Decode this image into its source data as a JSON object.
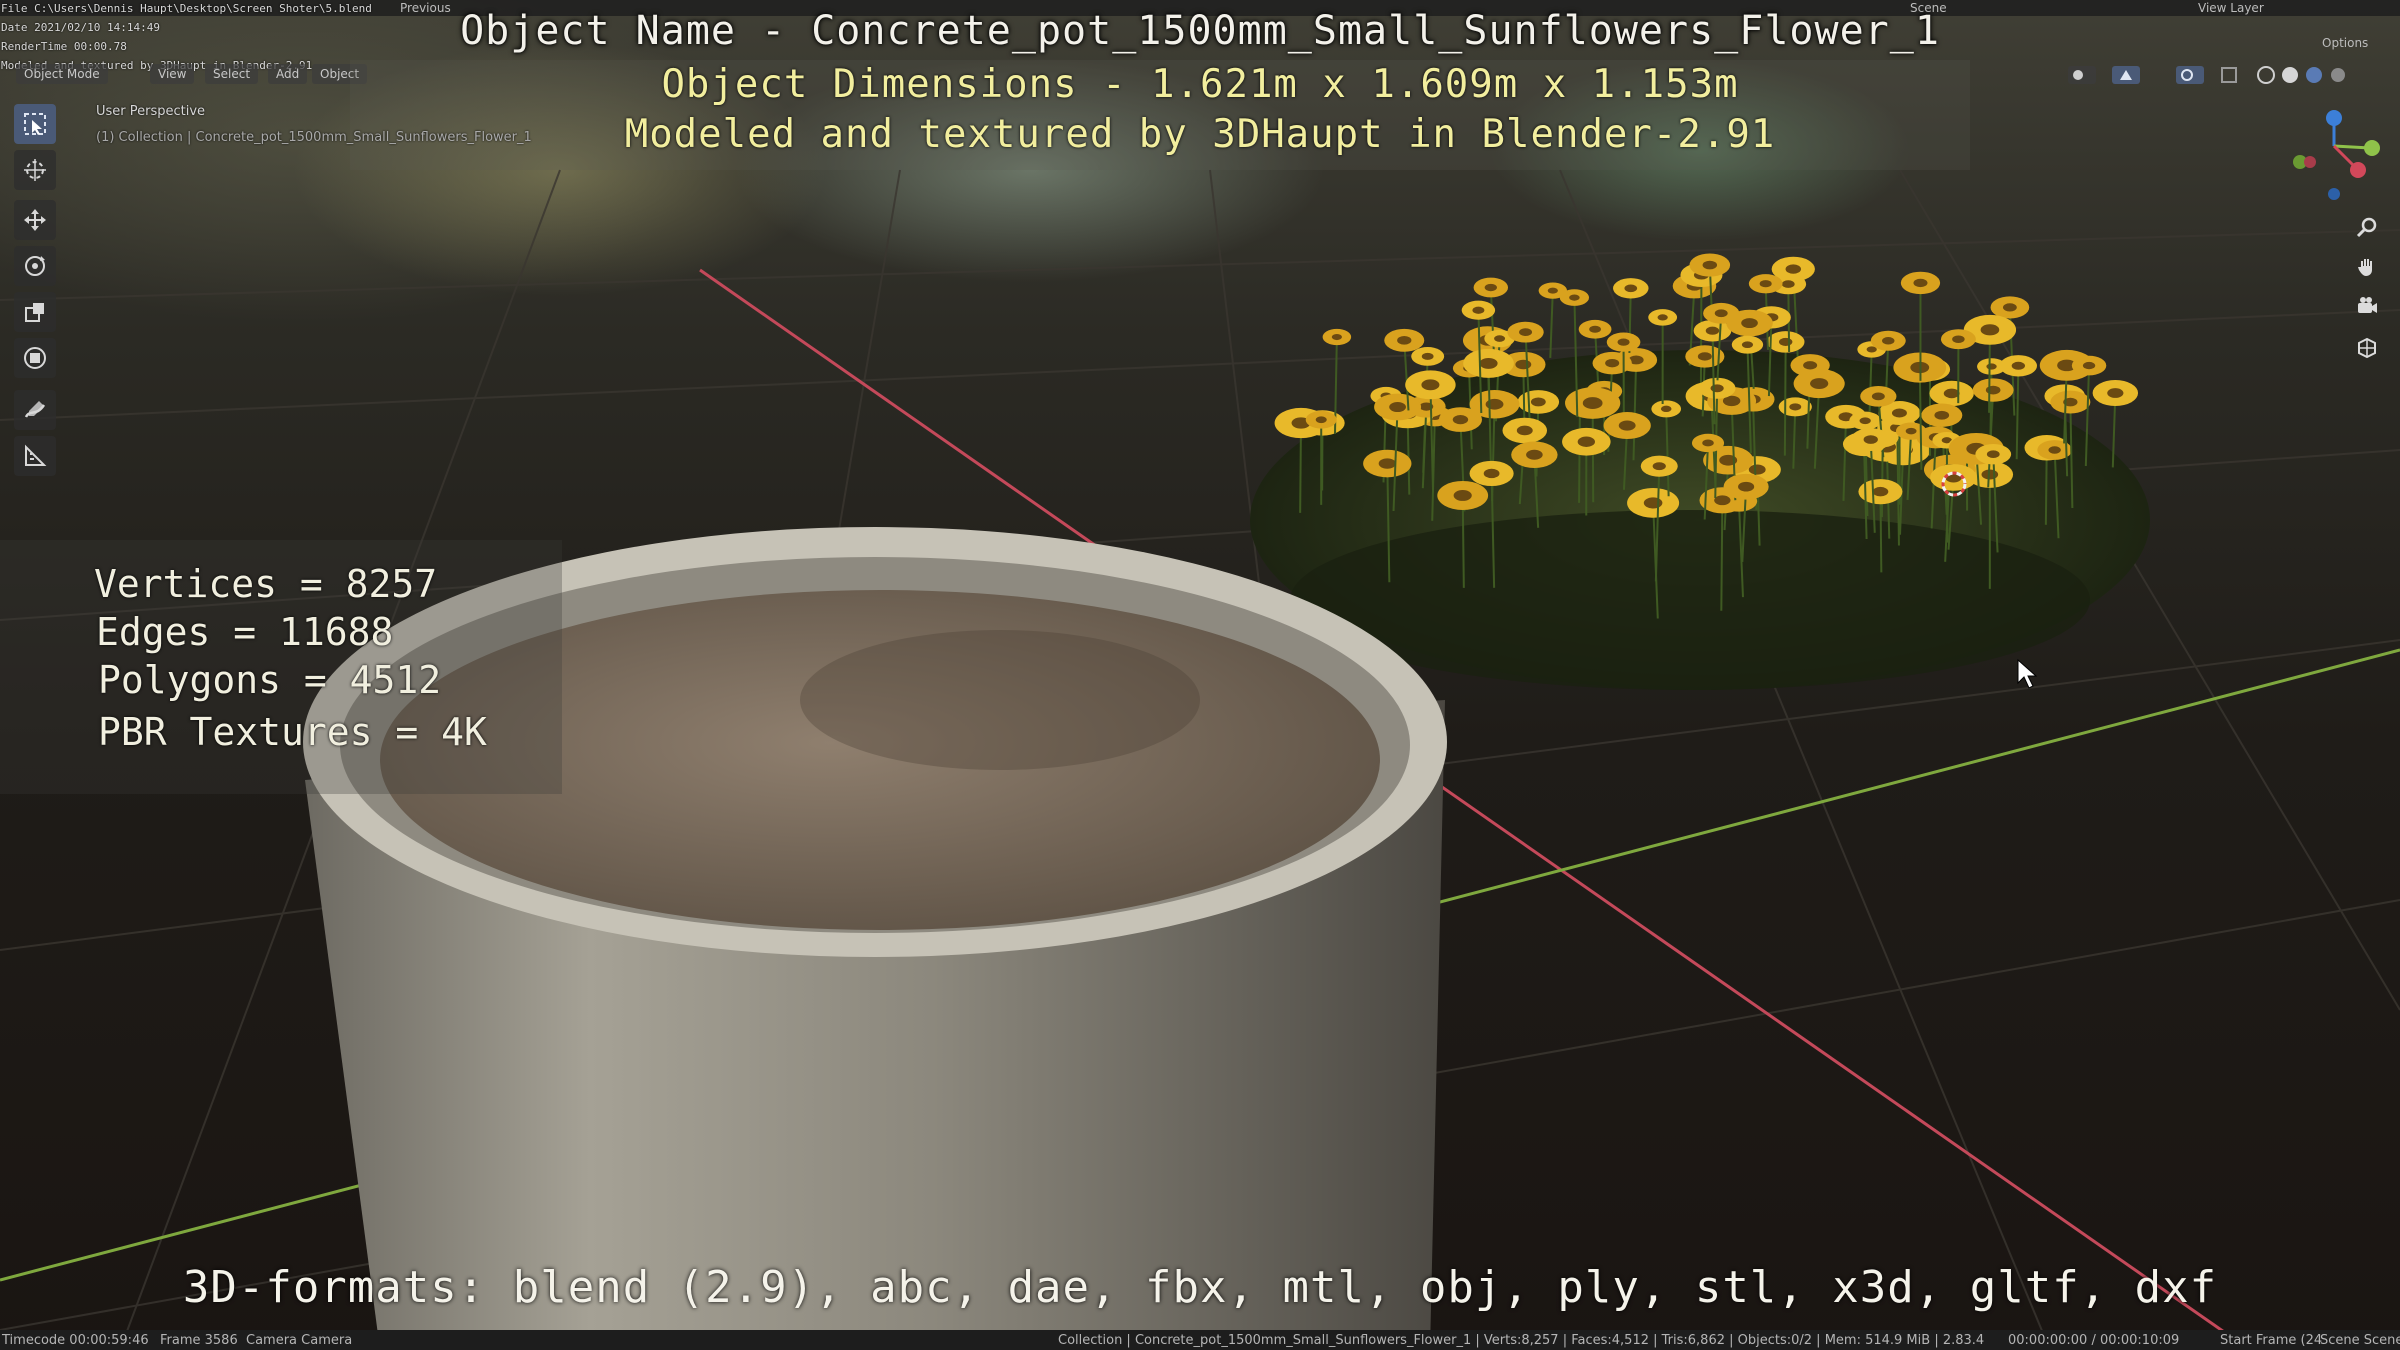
{
  "overlay": {
    "object_name": "Object Name - Concrete_pot_1500mm_Small_Sunflowers_Flower_1",
    "dimensions": "Object Dimensions -  1.621m x 1.609m x 1.153m",
    "credit": "Modeled and textured by 3DHaupt in Blender-2.91",
    "stats": {
      "vertices": "Vertices = 8257",
      "edges": "Edges = 11688",
      "polygons": "Polygons = 4512",
      "textures": "PBR Textures = 4K"
    },
    "formats": "3D-formats: blend (2.9), abc, dae, fbx, mtl, obj, ply, stl, x3d, gltf, dxf"
  },
  "render_stamp": {
    "file": "File C:\\Users\\Dennis Haupt\\Desktop\\Screen Shoter\\5.blend",
    "date": "Date 2021/02/10 14:14:49",
    "render_time": "RenderTime 00:00.78",
    "note": "Modeled and textured by 3DHaupt in Blender-2.91"
  },
  "topbar": {
    "previous": "Previous",
    "scene": "Scene",
    "view_layer": "View Layer",
    "options": "Options"
  },
  "header_menu": {
    "mode": "Object Mode",
    "items": [
      "View",
      "Select",
      "Add",
      "Object"
    ]
  },
  "viewport": {
    "perspective": "User Perspective",
    "collection": "(1) Collection | Concrete_pot_1500mm_Small_Sunflowers_Flower_1"
  },
  "toolbar_icons": [
    "select-box-icon",
    "cursor-icon",
    "move-icon",
    "rotate-icon",
    "scale-icon",
    "transform-icon",
    "annotate-icon",
    "measure-icon"
  ],
  "nav_icons": [
    "zoom-icon",
    "pan-hand-icon",
    "camera-view-icon",
    "ortho-grid-icon"
  ],
  "statusbar": {
    "timecode": "Timecode 00:00:59:46",
    "frame": "Frame 3586",
    "camera": "Camera Camera",
    "info": "Collection | Concrete_pot_1500mm_Small_Sunflowers_Flower_1 | Verts:8,257 | Faces:4,512 | Tris:6,862 | Objects:0/2 | Mem: 514.9 MiB | 2.83.4",
    "time_range": "00:00:00:00 / 00:00:10:09",
    "start_frame": "Start Frame (24",
    "scene_right": "Scene Scene"
  },
  "colors": {
    "accent_yellow": "#f2ee9e",
    "overlay_white": "#f3f1ea",
    "x_axis": "#d2485a",
    "y_axis": "#8fc24a",
    "z_axis": "#3c7fd8",
    "active_tool": "#4a5a77"
  }
}
